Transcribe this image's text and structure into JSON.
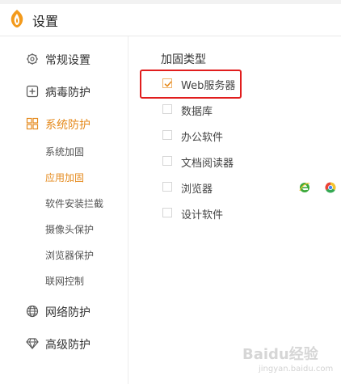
{
  "window": {
    "title": "设置"
  },
  "sidebar": {
    "items": [
      {
        "label": "常规设置",
        "icon": "gear-icon"
      },
      {
        "label": "病毒防护",
        "icon": "plus-square-icon"
      },
      {
        "label": "系统防护",
        "icon": "grid-icon",
        "active": true
      },
      {
        "label": "网络防护",
        "icon": "globe-icon"
      },
      {
        "label": "高级防护",
        "icon": "diamond-icon"
      }
    ],
    "sub_items": [
      {
        "label": "系统加固"
      },
      {
        "label": "应用加固",
        "active": true
      },
      {
        "label": "软件安装拦截"
      },
      {
        "label": "摄像头保护"
      },
      {
        "label": "浏览器保护"
      },
      {
        "label": "联网控制"
      }
    ]
  },
  "main": {
    "section_title": "加固类型",
    "options": [
      {
        "label": "Web服务器",
        "checked": true
      },
      {
        "label": "数据库",
        "checked": false
      },
      {
        "label": "办公软件",
        "checked": false
      },
      {
        "label": "文档阅读器",
        "checked": false
      },
      {
        "label": "浏览器",
        "checked": false
      },
      {
        "label": "设计软件",
        "checked": false
      }
    ],
    "browser_icons": [
      "ie-icon",
      "chrome-icon"
    ]
  },
  "watermark": {
    "text": "Baidu经验",
    "sub": "jingyan.baidu.com"
  },
  "colors": {
    "accent": "#e58a1d",
    "highlight": "#e11d1d"
  }
}
